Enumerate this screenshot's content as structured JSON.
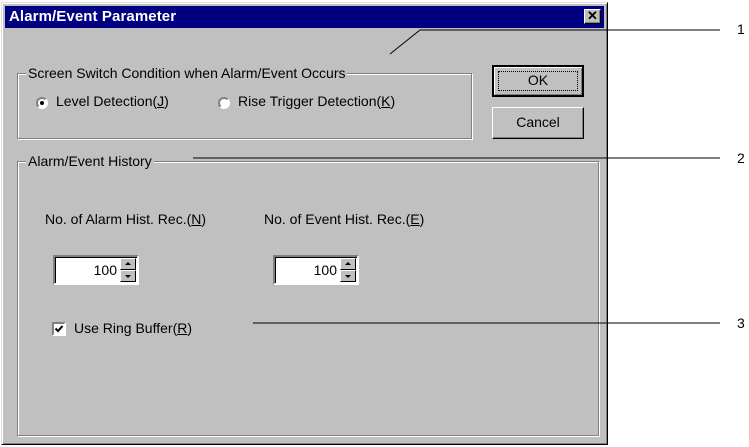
{
  "dialog": {
    "title": "Alarm/Event Parameter",
    "close_glyph": "✕"
  },
  "screen_switch": {
    "legend": "Screen Switch Condition when Alarm/Event Occurs",
    "options": [
      {
        "label": "Level Detection(",
        "hotkey": "J",
        "suffix": ")",
        "checked": true
      },
      {
        "label": "Rise Trigger Detection(",
        "hotkey": "K",
        "suffix": ")",
        "checked": false
      }
    ]
  },
  "buttons": {
    "ok": "OK",
    "cancel": "Cancel"
  },
  "history": {
    "legend": "Alarm/Event History",
    "alarm": {
      "label": "No. of Alarm Hist. Rec.(",
      "hotkey": "N",
      "suffix": ")",
      "value": "100"
    },
    "event": {
      "label": "No. of Event Hist. Rec.(",
      "hotkey": "E",
      "suffix": ")",
      "value": "100"
    },
    "ring_buffer": {
      "label": "Use Ring Buffer(",
      "hotkey": "R",
      "suffix": ")",
      "checked": true
    }
  },
  "callouts": [
    "1",
    "2",
    "3"
  ],
  "colors": {
    "face": "#c0c0c0",
    "titlebar": "#000080"
  }
}
